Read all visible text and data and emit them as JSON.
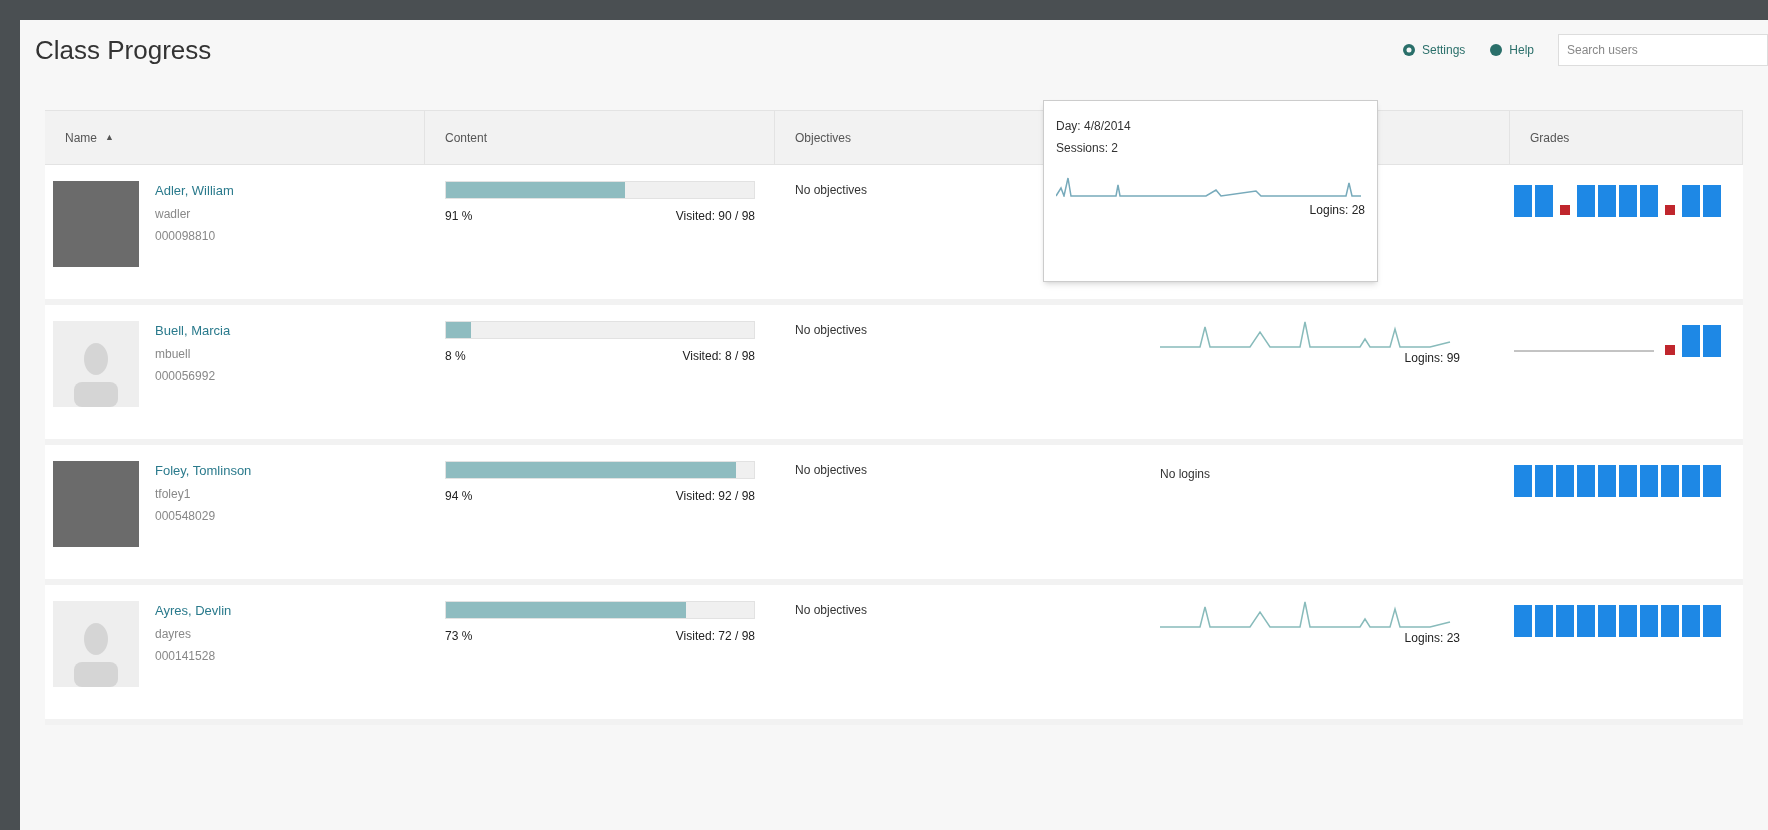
{
  "title": "Class Progress",
  "toolbar": {
    "settings": "Settings",
    "help": "Help",
    "search": {
      "placeholder": "Search users"
    }
  },
  "table": {
    "columns": [
      {
        "label": "Name",
        "sort": "▲"
      },
      {
        "label": "Content"
      },
      {
        "label": "Objectives"
      },
      {},
      {
        "label": "Grades"
      }
    ],
    "rows": [
      {
        "avatar": {
          "kind": "photo"
        },
        "name": "Adler, William",
        "username": "wadler",
        "id": "000098810",
        "level": 0.58,
        "percent": "91 %",
        "visited": "Visited: 90 / 98",
        "objectives": "No objectives",
        "logins": {
          "kind": "sparkline",
          "count": "Logins: 28"
        }
      },
      {
        "avatar": {
          "kind": "default"
        },
        "name": "Buell, Marcia",
        "username": "mbuell",
        "id": "000056992",
        "level": 0.08,
        "percent": "8 %",
        "visited": "Visited: 8 / 98",
        "objectives": "No objectives",
        "logins": {
          "kind": "sparkline",
          "count": "Logins: 99"
        }
      },
      {
        "avatar": {
          "kind": "photo"
        },
        "name": "Foley, Tomlinson",
        "username": "tfoley1",
        "id": "000548029",
        "level": 0.94,
        "percent": "94 %",
        "visited": "Visited: 92 / 98",
        "objectives": "No objectives",
        "logins": {
          "kind": "none",
          "text": "No logins"
        }
      },
      {
        "avatar": {
          "kind": "default"
        },
        "name": "Ayres, Devlin",
        "username": "dayres",
        "id": "000141528",
        "level": 0.78,
        "percent": "73 %",
        "visited": "Visited: 72 / 98",
        "objectives": "No objectives",
        "logins": {
          "kind": "sparkline",
          "count": "Logins: 23"
        }
      }
    ]
  },
  "tooltip": {
    "date": "Day: 4/8/2014",
    "sessions": "Sessions: 2"
  }
}
